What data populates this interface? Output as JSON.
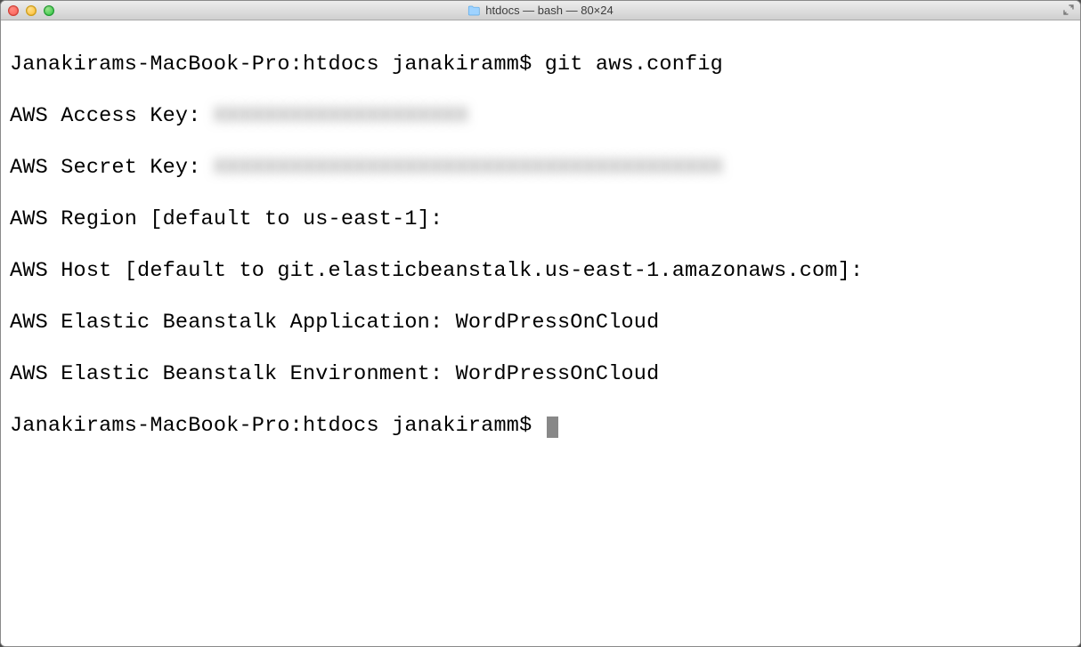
{
  "window": {
    "title": "htdocs — bash — 80×24"
  },
  "terminal": {
    "prompt": "Janakirams-MacBook-Pro:htdocs janakiramm$ ",
    "command": "git aws.config",
    "lines": {
      "access_label": "AWS Access Key: ",
      "access_value": "XXXXXXXXXXXXXXXXXXXX",
      "secret_label": "AWS Secret Key: ",
      "secret_value": "XXXXXXXXXXXXXXXXXXXXXXXXXXXXXXXXXXXXXXXX",
      "region": "AWS Region [default to us-east-1]:",
      "host": "AWS Host [default to git.elasticbeanstalk.us-east-1.amazonaws.com]:",
      "app": "AWS Elastic Beanstalk Application: WordPressOnCloud",
      "env": "AWS Elastic Beanstalk Environment: WordPressOnCloud"
    }
  }
}
